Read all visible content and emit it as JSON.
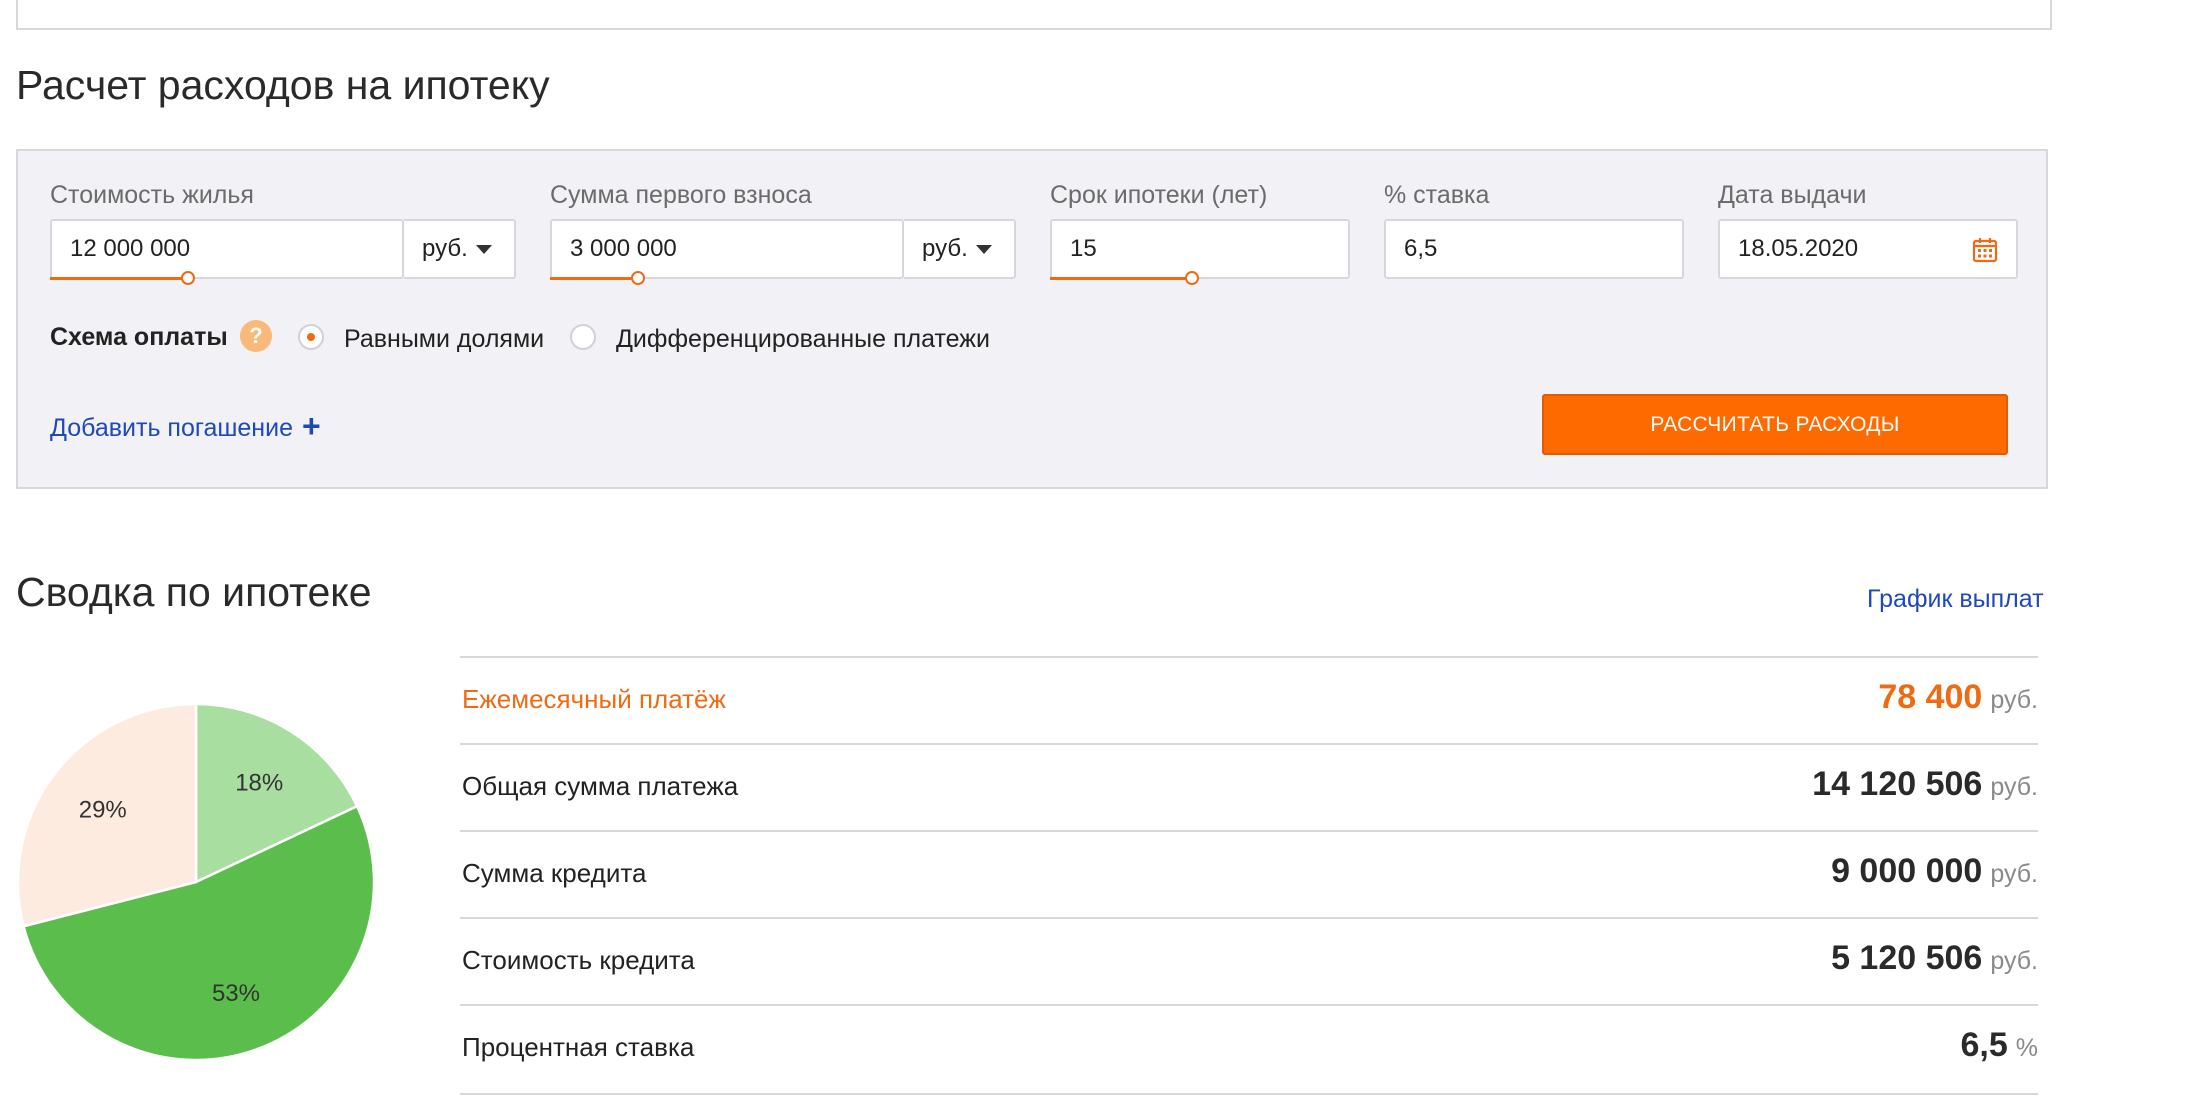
{
  "calculator": {
    "title": "Расчет расходов на ипотеку",
    "price": {
      "label": "Стоимость жилья",
      "value": "12 000 000",
      "currency": "руб."
    },
    "down_payment": {
      "label": "Сумма первого взноса",
      "value": "3 000 000",
      "currency": "руб."
    },
    "term": {
      "label": "Срок ипотеки (лет)",
      "value": "15"
    },
    "rate": {
      "label": "% ставка",
      "value": "6,5"
    },
    "issue_date": {
      "label": "Дата выдачи",
      "value": "18.05.2020"
    },
    "payment_scheme": {
      "label": "Схема оплаты",
      "help": "?",
      "options": [
        {
          "label": "Равными долями",
          "selected": true
        },
        {
          "label": "Дифференцированные платежи",
          "selected": false
        }
      ]
    },
    "add_repayment_label": "Добавить погашение",
    "add_repayment_icon": "plus-icon",
    "plus_glyph": "+",
    "calculate_button": "РАССЧИТАТЬ РАСХОДЫ"
  },
  "summary": {
    "title": "Сводка по ипотеке",
    "schedule_link": "График выплат",
    "rows": [
      {
        "label": "Ежемесячный платёж",
        "value": "78 400",
        "unit": "руб."
      },
      {
        "label": "Общая сумма платежа",
        "value": "14 120 506",
        "unit": "руб."
      },
      {
        "label": "Сумма кредита",
        "value": "9 000 000",
        "unit": "руб."
      },
      {
        "label": "Стоимость кредита",
        "value": "5 120 506",
        "unit": "руб."
      },
      {
        "label": "Процентная ставка",
        "value": "6,5",
        "unit": "%"
      }
    ]
  },
  "chart_data": {
    "type": "pie",
    "slices": [
      {
        "label": "18%",
        "value": 18,
        "color": "#a8dea0"
      },
      {
        "label": "53%",
        "value": 53,
        "color": "#5bbd4b"
      },
      {
        "label": "29%",
        "value": 29,
        "color": "#fdebe0"
      }
    ]
  },
  "colors": {
    "accent": "#ee6b14",
    "button": "#ff6a00",
    "link": "#1f49b6",
    "panel": "#f1f1f6"
  }
}
